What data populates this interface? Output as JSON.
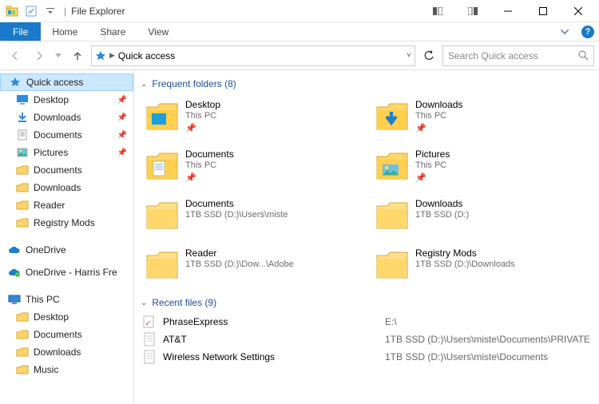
{
  "window": {
    "title": "File Explorer"
  },
  "ribbon": {
    "file": "File",
    "home": "Home",
    "share": "Share",
    "view": "View"
  },
  "address": {
    "crumb": "Quick access"
  },
  "search": {
    "placeholder": "Search Quick access"
  },
  "sidebar": {
    "quick_access": "Quick access",
    "pinned": [
      {
        "label": "Desktop"
      },
      {
        "label": "Downloads"
      },
      {
        "label": "Documents"
      },
      {
        "label": "Pictures"
      }
    ],
    "recent": [
      {
        "label": "Documents"
      },
      {
        "label": "Downloads"
      },
      {
        "label": "Reader"
      },
      {
        "label": "Registry Mods"
      }
    ],
    "onedrive": "OneDrive",
    "onedrive2": "OneDrive - Harris Fre",
    "thispc": "This PC",
    "thispc_items": [
      {
        "label": "Desktop"
      },
      {
        "label": "Documents"
      },
      {
        "label": "Downloads"
      },
      {
        "label": "Music"
      }
    ]
  },
  "sections": {
    "frequent": {
      "title": "Frequent folders (8)"
    },
    "recent": {
      "title": "Recent files (9)"
    }
  },
  "folders": [
    {
      "name": "Desktop",
      "loc": "This PC",
      "pin": true,
      "icon": "desktop"
    },
    {
      "name": "Downloads",
      "loc": "This PC",
      "pin": true,
      "icon": "downloads"
    },
    {
      "name": "Documents",
      "loc": "This PC",
      "pin": true,
      "icon": "documents"
    },
    {
      "name": "Pictures",
      "loc": "This PC",
      "pin": true,
      "icon": "pictures"
    },
    {
      "name": "Documents",
      "loc": "1TB SSD (D:)\\Users\\miste",
      "pin": false,
      "icon": "folder"
    },
    {
      "name": "Downloads",
      "loc": "1TB SSD (D:)",
      "pin": false,
      "icon": "folder"
    },
    {
      "name": "Reader",
      "loc": "1TB SSD (D:)\\Dow...\\Adobe",
      "pin": false,
      "icon": "folder"
    },
    {
      "name": "Registry Mods",
      "loc": "1TB SSD (D:)\\Downloads",
      "pin": false,
      "icon": "folder"
    }
  ],
  "files": [
    {
      "name": "PhraseExpress",
      "loc": "E:\\",
      "icon": "shortcut"
    },
    {
      "name": "AT&T",
      "loc": "1TB SSD (D:)\\Users\\miste\\Documents\\PRIVATE",
      "icon": "text"
    },
    {
      "name": "Wireless Network Settings",
      "loc": "1TB SSD (D:)\\Users\\miste\\Documents",
      "icon": "text"
    }
  ]
}
